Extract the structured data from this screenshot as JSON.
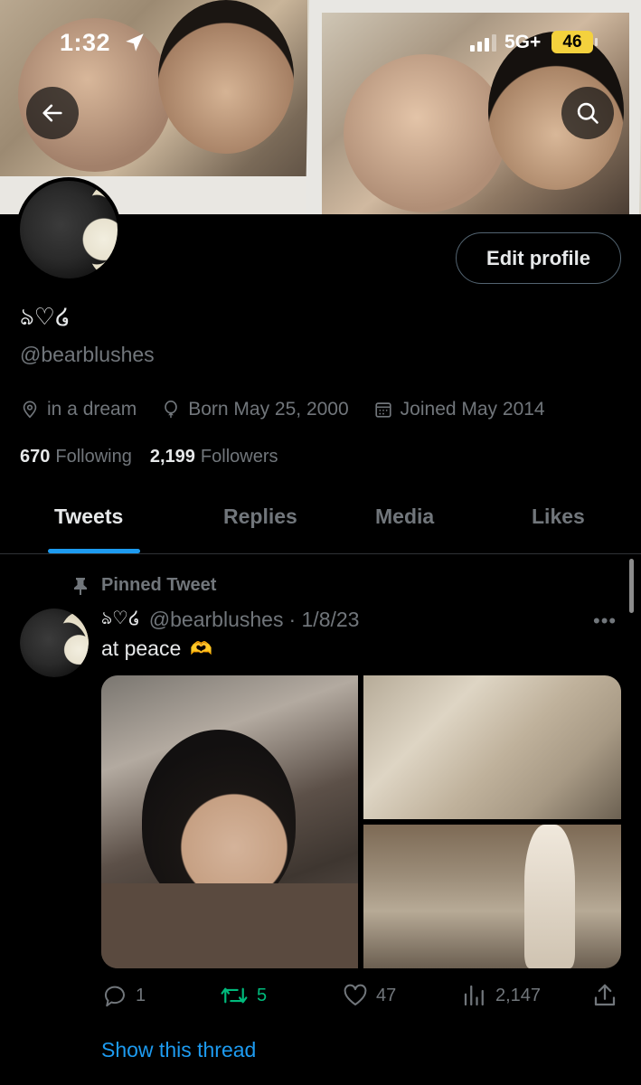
{
  "status_bar": {
    "time": "1:32",
    "network": "5G+",
    "battery": "46"
  },
  "profile": {
    "display_name": "ঌ♡໒",
    "handle": "@bearblushes",
    "edit_button": "Edit profile",
    "location": "in a dream",
    "birthday": "Born May 25, 2000",
    "joined": "Joined May 2014",
    "following_count": "670",
    "following_label": "Following",
    "followers_count": "2,199",
    "followers_label": "Followers"
  },
  "tabs": [
    {
      "label": "Tweets",
      "active": true
    },
    {
      "label": "Replies",
      "active": false
    },
    {
      "label": "Media",
      "active": false
    },
    {
      "label": "Likes",
      "active": false
    }
  ],
  "tweet": {
    "pinned_label": "Pinned Tweet",
    "author_name": "ঌ♡໒",
    "author_handle": "@bearblushes",
    "date": "· 1/8/23",
    "more": "•••",
    "text": "at peace",
    "emoji": "🫶",
    "replies": "1",
    "retweets": "5",
    "likes": "47",
    "views": "2,147",
    "show_thread": "Show this thread"
  },
  "icons": {
    "back": "arrow-left-icon",
    "search": "search-icon",
    "location": "location-pin-icon",
    "birthday": "balloon-icon",
    "joined": "calendar-icon",
    "pin": "pin-icon",
    "reply": "reply-icon",
    "retweet": "retweet-icon",
    "like": "heart-icon",
    "views": "views-chart-icon",
    "share": "share-icon"
  },
  "colors": {
    "accent": "#1d9bf0",
    "retweet": "#00ba7c",
    "muted": "#71767b",
    "battery": "#f4d13d"
  }
}
